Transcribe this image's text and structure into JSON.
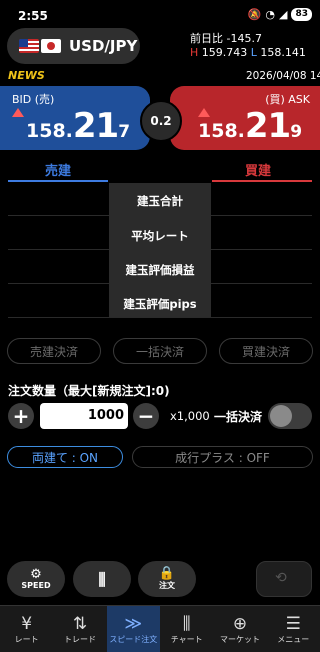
{
  "status_bar": {
    "time": "2:55",
    "battery": "83"
  },
  "pair": {
    "name": "USD/JPY"
  },
  "prev_day": {
    "label": "前日比",
    "value": "-145.7"
  },
  "high_low": {
    "h_label": "H",
    "high": "159.743",
    "l_label": "L",
    "low": "158.141"
  },
  "news_label": "NEWS",
  "datetime": "2026/04/08 14",
  "bid": {
    "label": "BID (売)",
    "price_small": "158.",
    "price_big": "21",
    "price_tail": "7"
  },
  "ask": {
    "label": "(買) ASK",
    "price_small": "158.",
    "price_big": "21",
    "price_tail": "9"
  },
  "spread": "0.2",
  "tabs": {
    "sell": "売建",
    "buy": "買建"
  },
  "popup_items": [
    "建玉合計",
    "平均レート",
    "建玉評価損益",
    "建玉評価pips"
  ],
  "settle_buttons": [
    "売建決済",
    "一括決済",
    "買建決済"
  ],
  "order": {
    "label": "注文数量（最大[新規注文]:0)",
    "quantity": "1000",
    "multiplier": "x1,000",
    "all_settle": "一括決済",
    "toggle_on": false
  },
  "options": {
    "ryodate": "両建て : ON",
    "nariyuki": "成行プラス : OFF"
  },
  "actions": {
    "speed": "SPEED",
    "order": "注文"
  },
  "nav": [
    {
      "label": "レート",
      "icon": "¥"
    },
    {
      "label": "トレード",
      "icon": "⇅"
    },
    {
      "label": "スピード注文",
      "icon": "≫"
    },
    {
      "label": "チャート",
      "icon": "⫼"
    },
    {
      "label": "マーケット",
      "icon": "⊕"
    },
    {
      "label": "メニュー",
      "icon": "☰"
    }
  ],
  "colors": {
    "bid": "#1f4f9a",
    "ask": "#b8262b",
    "news": "#f0c419",
    "accent": "#3d7be0"
  }
}
